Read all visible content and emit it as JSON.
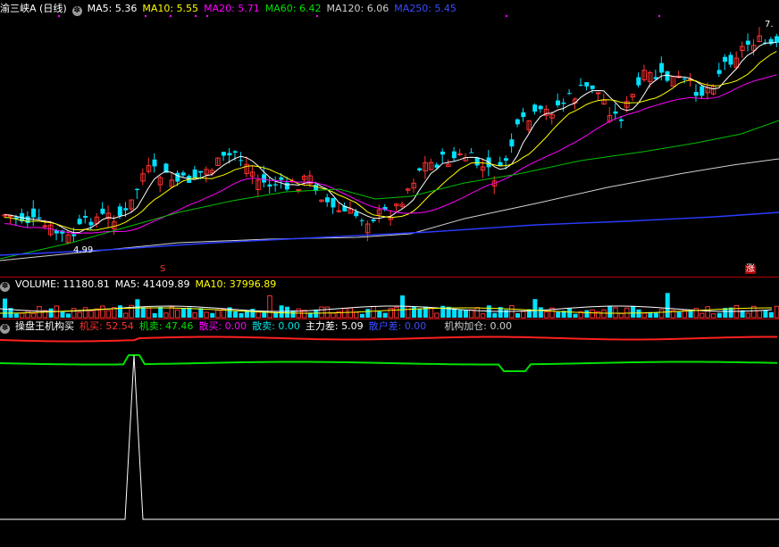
{
  "price_header": {
    "title": "渝三峡A (日线)",
    "ma5_label": "MA5:",
    "ma5": "5.36",
    "ma10_label": "MA10:",
    "ma10": "5.55",
    "ma20_label": "MA20:",
    "ma20": "5.71",
    "ma60_label": "MA60:",
    "ma60": "6.42",
    "ma120_label": "MA120:",
    "ma120": "6.06",
    "ma250_label": "MA250:",
    "ma250": "5.45"
  },
  "price_annotations": {
    "low": "4.99",
    "high": "7.",
    "signal_s": "S",
    "signal_zhang": "涨"
  },
  "volume_header": {
    "label": "VOLUME:",
    "value": "11180.81",
    "ma5_label": "MA5:",
    "ma5": "41409.89",
    "ma10_label": "MA10:",
    "ma10": "37996.89"
  },
  "indicator_header": {
    "title": "操盘王机构买",
    "buy_label": "机买:",
    "buy": "52.54",
    "sell_label": "机卖:",
    "sell": "47.46",
    "retail_buy_label": "散买:",
    "retail_buy": "0.00",
    "retail_sell_label": "散卖:",
    "retail_sell": "0.00",
    "diff_label": "主力差:",
    "diff": "5.09",
    "retail_diff_label": "散户差:",
    "retail_diff": "0.00",
    "add_label": "机构加仓:",
    "add": "0.00"
  },
  "colors": {
    "up": "#ff3232",
    "down": "#00e0ff",
    "ma5": "#ffffff",
    "ma10": "#ffff00",
    "ma20": "#ff00ff",
    "ma60": "#00c000",
    "ma120": "#d0d0d0",
    "ma250": "#2a3cff"
  },
  "icons": [
    "gear-icon"
  ]
}
